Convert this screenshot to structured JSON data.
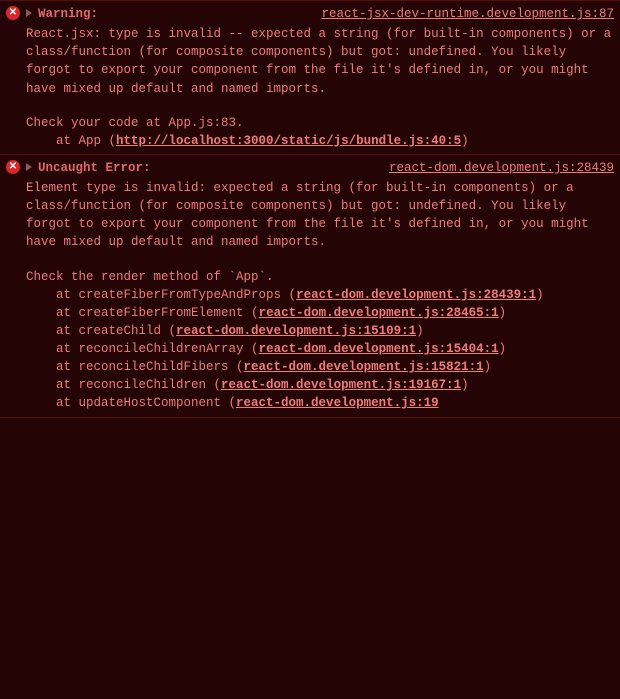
{
  "entries": [
    {
      "label": "Warning:",
      "source": "react-jsx-dev-runtime.development.js:87",
      "message": "React.jsx: type is invalid -- expected a string (for built-in components) or a class/function (for composite components) but got: undefined. You likely forgot to export your component from the file it's defined in, or you might have mixed up default and named imports.",
      "message2": "Check your code at App.js:83.",
      "stack": [
        {
          "prefix": "    at App (",
          "link": "http://localhost:3000/static/js/bundle.js:40:5",
          "suffix": ")"
        }
      ]
    },
    {
      "label": "Uncaught Error:",
      "source": "react-dom.development.js:28439",
      "message": "Element type is invalid: expected a string (for built-in components) or a class/function (for composite components) but got: undefined. You likely forgot to export your component from the file it's defined in, or you might have mixed up default and named imports.",
      "message2": "Check the render method of `App`.",
      "stack": [
        {
          "prefix": "    at createFiberFromTypeAndProps (",
          "link": "react-dom.development.js:28439:1",
          "suffix": ")"
        },
        {
          "prefix": "    at createFiberFromElement (",
          "link": "react-dom.development.js:28465:1",
          "suffix": ")"
        },
        {
          "prefix": "    at createChild (",
          "link": "react-dom.development.js:15109:1",
          "suffix": ")"
        },
        {
          "prefix": "    at reconcileChildrenArray (",
          "link": "react-dom.development.js:15404:1",
          "suffix": ")"
        },
        {
          "prefix": "    at reconcileChildFibers (",
          "link": "react-dom.development.js:15821:1",
          "suffix": ")"
        },
        {
          "prefix": "    at reconcileChildren (",
          "link": "react-dom.development.js:19167:1",
          "suffix": ")"
        },
        {
          "prefix": "    at updateHostComponent (",
          "link": "react-dom.development.js:19",
          "suffix": ""
        }
      ]
    }
  ]
}
